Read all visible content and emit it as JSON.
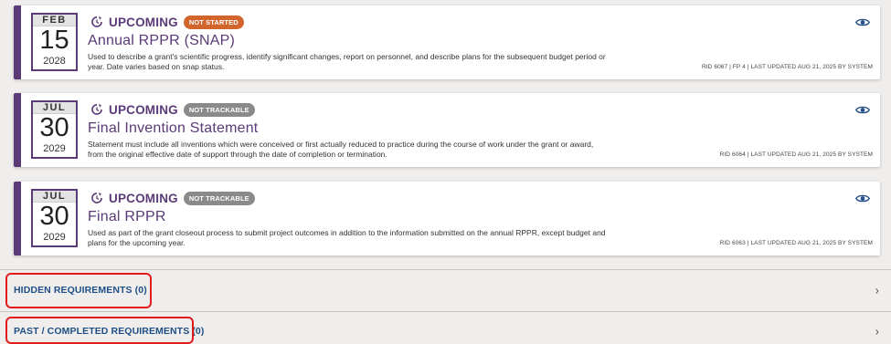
{
  "requirements": [
    {
      "month": "FEB",
      "day": "15",
      "year": "2028",
      "status": "UPCOMING",
      "badge": "NOT STARTED",
      "badge_color": "#d2652b",
      "title": "Annual RPPR (SNAP)",
      "description": "Used to describe a grant's scientific progress, identify significant changes, report on personnel, and describe plans for the subsequent budget period or year. Date varies based on snap status.",
      "meta": "RID 6067 | FP 4 | LAST UPDATED AUG 21, 2025 BY SYSTEM"
    },
    {
      "month": "JUL",
      "day": "30",
      "year": "2029",
      "status": "UPCOMING",
      "badge": "NOT TRACKABLE",
      "badge_color": "#8a8a8a",
      "title": "Final Invention Statement",
      "description": "Statement must include all inventions which were conceived or first actually reduced to practice during the course of work under the grant or award, from the original effective date of support through the date of completion or termination.",
      "meta": "RID 6064 | LAST UPDATED AUG 21, 2025 BY SYSTEM"
    },
    {
      "month": "JUL",
      "day": "30",
      "year": "2029",
      "status": "UPCOMING",
      "badge": "NOT TRACKABLE",
      "badge_color": "#8a8a8a",
      "title": "Final RPPR",
      "description": "Used as part of the grant closeout process to submit project outcomes in addition to the information submitted on the annual RPPR, except budget and plans for the upcoming year.",
      "meta": "RID 6063 | LAST UPDATED AUG 21, 2025 BY SYSTEM"
    }
  ],
  "sections": {
    "hidden": {
      "label": "HIDDEN REQUIREMENTS (0)"
    },
    "past": {
      "label": "PAST / COMPLETED REQUIREMENTS (0)"
    }
  },
  "icons": {
    "status": "clock-refresh-icon",
    "view": "eye-icon",
    "expand": "chevron-right-icon"
  },
  "colors": {
    "accent": "#5b3a78",
    "link": "#1f4f86",
    "highlight": "#e21c1c"
  }
}
